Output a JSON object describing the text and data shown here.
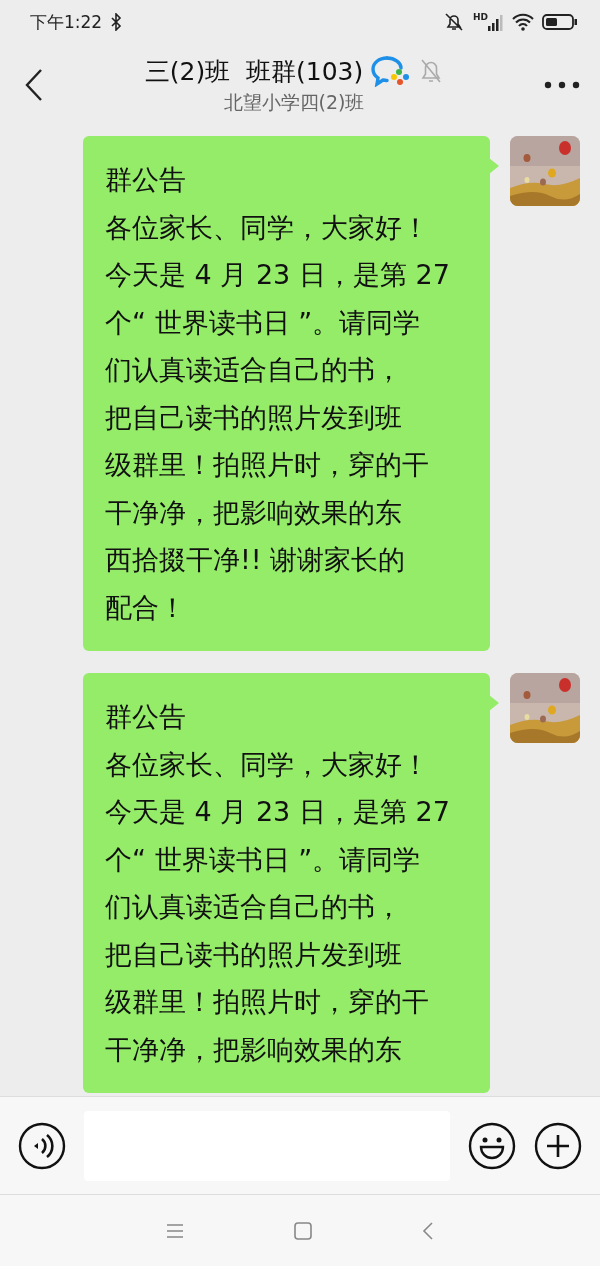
{
  "status_bar": {
    "time": "下午1:22",
    "network_label": "HD"
  },
  "header": {
    "title": "三(2)班  班群(103)",
    "subtitle": "北望小学四(2)班",
    "muted": true
  },
  "messages": [
    {
      "heading": "群公告",
      "lines": [
        "各位家长、同学，大家好！",
        "今天是 4 月 23 日，是第 27",
        "个“ 世界读书日 ”。请同学",
        "们认真读适合自己的书，",
        "把自己读书的照片发到班",
        "级群里！拍照片时，穿的干",
        "干净净，把影响效果的东",
        "西拾掇干净!! 谢谢家长的",
        "配合！"
      ]
    },
    {
      "heading": "群公告",
      "lines": [
        "各位家长、同学，大家好！",
        "今天是 4 月 23 日，是第 27",
        "个“ 世界读书日 ”。请同学",
        "们认真读适合自己的书，",
        "把自己读书的照片发到班",
        "级群里！拍照片时，穿的干",
        "干净净，把影响效果的东"
      ]
    }
  ]
}
